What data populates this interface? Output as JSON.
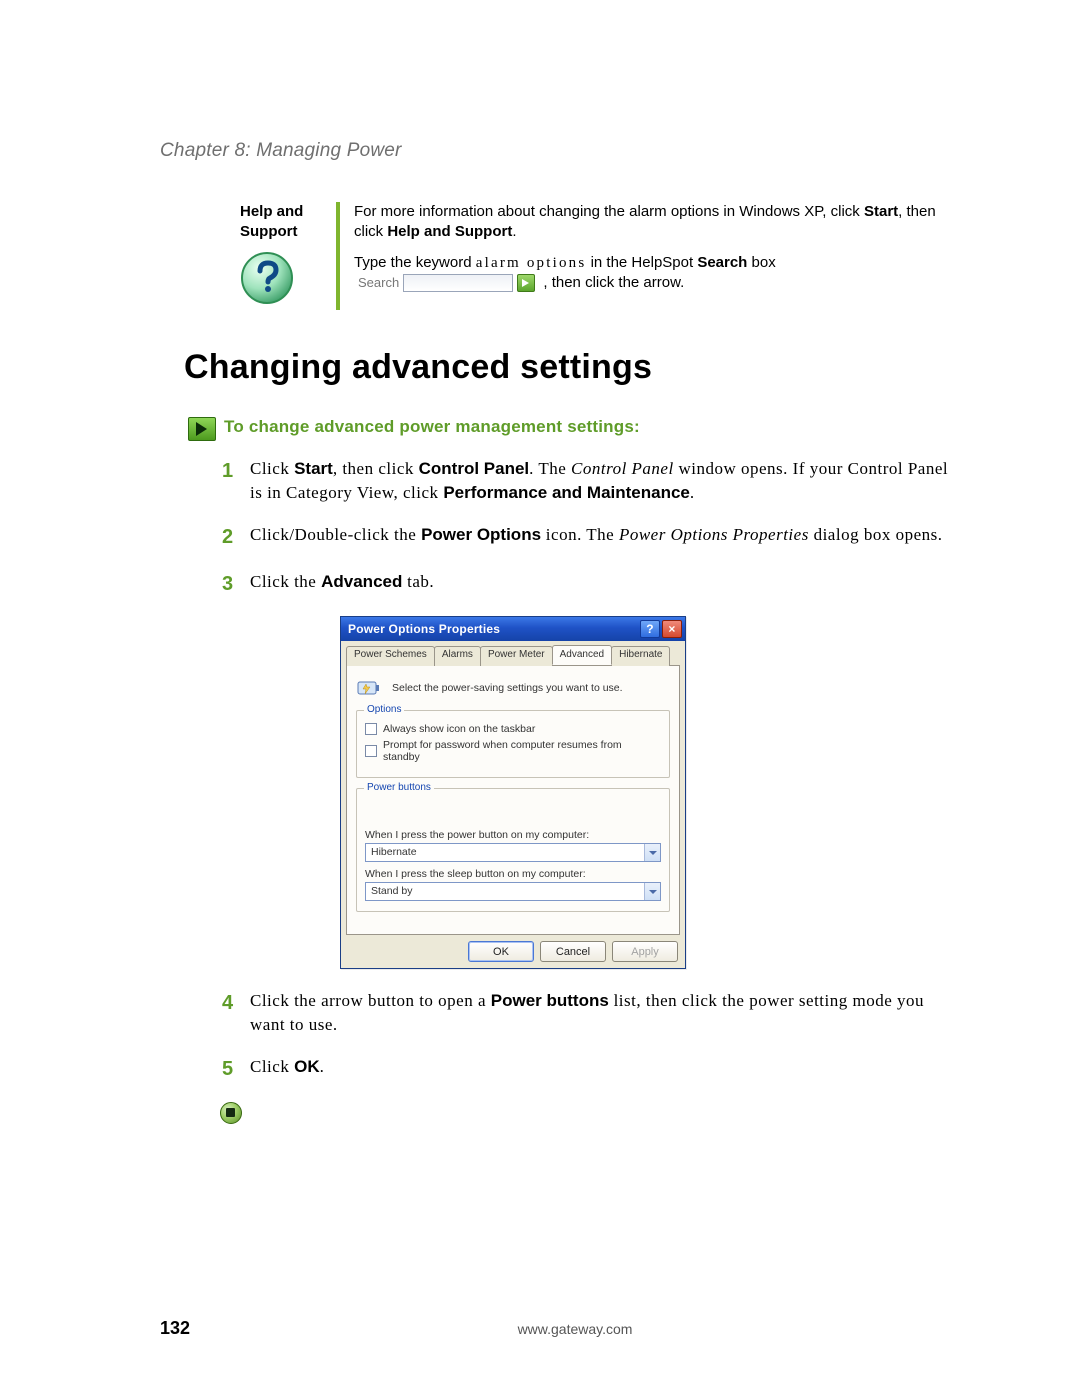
{
  "chapter_title": "Chapter 8: Managing Power",
  "help": {
    "label_line1": "Help and",
    "label_line2": "Support",
    "p1_pre": "For more information about changing the alarm options in Windows XP, click ",
    "p1_b1": "Start",
    "p1_mid": ", then click ",
    "p1_b2": "Help and Support",
    "p1_end": ".",
    "p2_pre": "Type the keyword ",
    "p2_kw": "alarm options",
    "p2_mid": " in the HelpSpot ",
    "p2_b1": "Search",
    "p2_box": " box ",
    "p2_end": " , then click the arrow.",
    "search_label": "Search"
  },
  "section_heading": "Changing advanced settings",
  "task_title": "To change advanced power management settings:",
  "steps": {
    "s1": {
      "num": "1",
      "t1": "Click ",
      "b1": "Start",
      "t2": ", then click ",
      "b2": "Control Panel",
      "t3": ". The ",
      "i1": "Control Panel",
      "t4": " window opens. If your Control Panel is in Category View, click ",
      "b3": "Performance and Maintenance",
      "t5": "."
    },
    "s2": {
      "num": "2",
      "t1": "Click/Double-click the ",
      "b1": "Power Options",
      "t2": " icon. The ",
      "i1": "Power Options Properties",
      "t3": " dialog box opens."
    },
    "s3": {
      "num": "3",
      "t1": "Click the ",
      "b1": "Advanced",
      "t2": " tab."
    },
    "s4": {
      "num": "4",
      "t1": "Click the arrow button to open a ",
      "b1": "Power buttons",
      "t2": " list, then click the power setting mode you want to use."
    },
    "s5": {
      "num": "5",
      "t1": "Click ",
      "b1": "OK",
      "t2": "."
    }
  },
  "dialog": {
    "title": "Power Options Properties",
    "help_btn": "?",
    "close_btn": "×",
    "tabs": [
      "Power Schemes",
      "Alarms",
      "Power Meter",
      "Advanced",
      "Hibernate"
    ],
    "active_tab_index": 3,
    "header_text": "Select the power-saving settings you want to use.",
    "options_legend": "Options",
    "chk1": "Always show icon on the taskbar",
    "chk2": "Prompt for password when computer resumes from standby",
    "pb_legend": "Power buttons",
    "pb_label1": "When I press the power button on my computer:",
    "pb_value1": "Hibernate",
    "pb_label2": "When I press the sleep button on my computer:",
    "pb_value2": "Stand by",
    "ok": "OK",
    "cancel": "Cancel",
    "apply": "Apply"
  },
  "footer": {
    "page": "132",
    "url": "www.gateway.com"
  }
}
